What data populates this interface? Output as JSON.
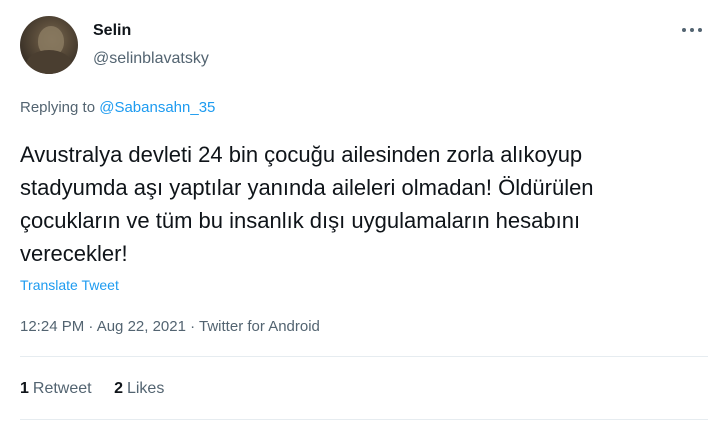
{
  "user": {
    "display_name": "Selin",
    "handle": "@selinblavatsky"
  },
  "reply": {
    "prefix": "Replying to",
    "mention": "@Sabansahn_35"
  },
  "tweet": {
    "text": "Avustralya devleti 24 bin çocuğu ailesinden zorla alıkoyup stadyumda aşı yaptılar yanında aileleri olmadan! Öldürülen çocukların ve tüm bu insanlık dışı uygulamaların hesabını verecekler!",
    "translate_label": "Translate Tweet",
    "meta": "12:24 PM · Aug 22, 2021 · Twitter for Android"
  },
  "stats": {
    "retweets_count": "1",
    "retweets_label": "Retweet",
    "likes_count": "2",
    "likes_label": "Likes"
  },
  "icons": {
    "more": "more-horizontal-icon"
  },
  "colors": {
    "link": "#1d9bf0",
    "secondary_text": "#536471",
    "primary_text": "#0f1419"
  }
}
